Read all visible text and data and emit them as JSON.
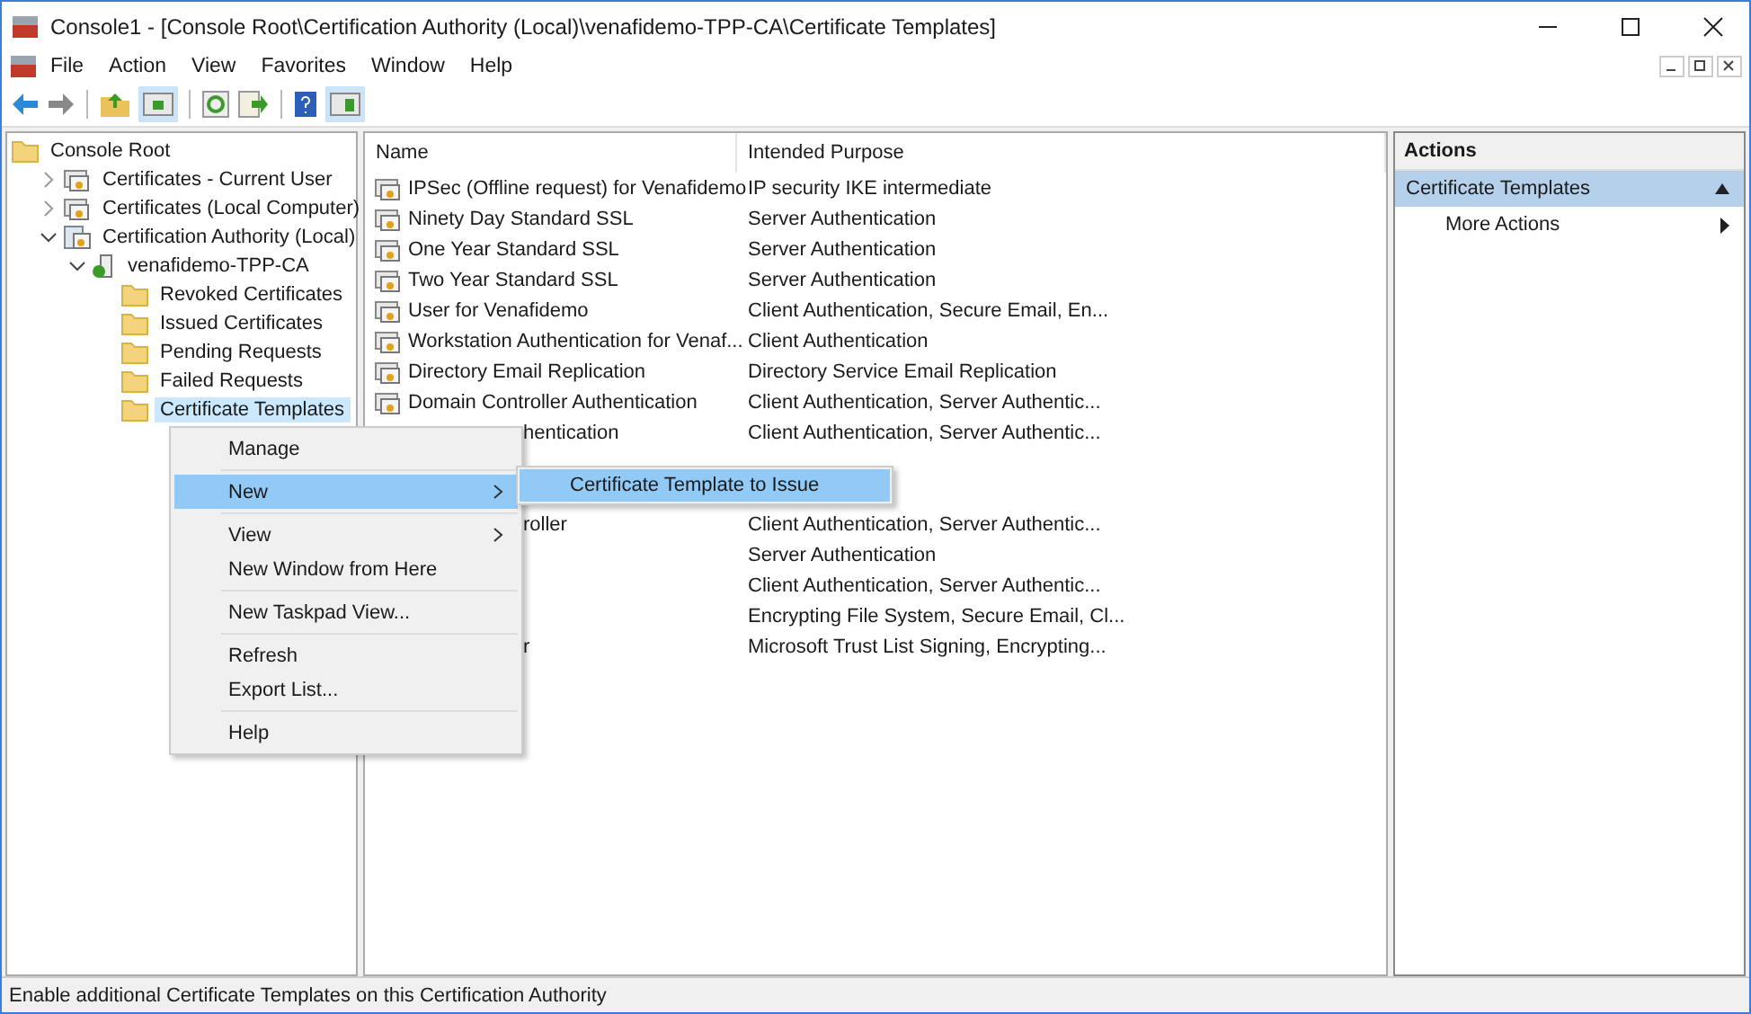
{
  "window": {
    "title": "Console1 - [Console Root\\Certification Authority (Local)\\venafidemo-TPP-CA\\Certificate Templates]"
  },
  "menu_bar": [
    "File",
    "Action",
    "View",
    "Favorites",
    "Window",
    "Help"
  ],
  "tree": [
    {
      "label": "Console Root",
      "children": [
        {
          "label": "Certificates - Current User",
          "expanded": false
        },
        {
          "label": "Certificates (Local Computer)",
          "expanded": false
        },
        {
          "label": "Certification Authority (Local)",
          "expanded": true,
          "children": [
            {
              "label": "venafidemo-TPP-CA",
              "expanded": true,
              "children": [
                {
                  "label": "Revoked Certificates",
                  "selected": false
                },
                {
                  "label": "Issued Certificates",
                  "selected": false
                },
                {
                  "label": "Pending Requests",
                  "selected": false
                },
                {
                  "label": "Failed Requests",
                  "selected": false
                },
                {
                  "label": "Certificate Templates",
                  "selected": true
                }
              ]
            }
          ]
        }
      ]
    }
  ],
  "list": {
    "columns": [
      "Name",
      "Intended Purpose"
    ],
    "rows": [
      {
        "kind": "full",
        "name": "IPSec (Offline request) for Venafidemo",
        "purpose": "IP security IKE intermediate"
      },
      {
        "kind": "full",
        "name": "Ninety Day Standard SSL",
        "purpose": "Server Authentication"
      },
      {
        "kind": "full",
        "name": "One Year Standard SSL",
        "purpose": "Server Authentication"
      },
      {
        "kind": "full",
        "name": "Two Year Standard SSL",
        "purpose": "Server Authentication"
      },
      {
        "kind": "full",
        "name": "User for Venafidemo",
        "purpose": "Client Authentication, Secure Email, En..."
      },
      {
        "kind": "full",
        "name": "Workstation Authentication for Venaf...",
        "purpose": "Client Authentication"
      },
      {
        "kind": "full",
        "name": "Directory Email Replication",
        "purpose": "Directory Service Email Replication"
      },
      {
        "kind": "full",
        "name": "Domain Controller Authentication",
        "purpose": "Client Authentication, Server Authentic..."
      },
      {
        "kind": "partial",
        "name": "hentication",
        "purpose": "Client Authentication, Server Authentic..."
      },
      {
        "kind": "hidden"
      },
      {
        "kind": "hidden"
      },
      {
        "kind": "partial",
        "name": "roller",
        "purpose": "Client Authentication, Server Authentic..."
      },
      {
        "kind": "partial",
        "purpose": "Server Authentication"
      },
      {
        "kind": "partial",
        "purpose": "Client Authentication, Server Authentic..."
      },
      {
        "kind": "partial",
        "purpose": "Encrypting File System, Secure Email, Cl..."
      },
      {
        "kind": "partial",
        "name": "r",
        "purpose": "Microsoft Trust List Signing, Encrypting..."
      }
    ]
  },
  "actions": {
    "title": "Actions",
    "section": "Certificate Templates",
    "items": [
      "More Actions"
    ]
  },
  "context_menu": {
    "groups": [
      [
        {
          "label": "Manage",
          "submenu": false,
          "selected": false
        }
      ],
      [
        {
          "label": "New",
          "submenu": true,
          "selected": true
        }
      ],
      [
        {
          "label": "View",
          "submenu": true,
          "selected": false
        },
        {
          "label": "New Window from Here",
          "submenu": false,
          "selected": false
        }
      ],
      [
        {
          "label": "New Taskpad View...",
          "submenu": false,
          "selected": false
        }
      ],
      [
        {
          "label": "Refresh",
          "submenu": false,
          "selected": false
        },
        {
          "label": "Export List...",
          "submenu": false,
          "selected": false
        }
      ],
      [
        {
          "label": "Help",
          "submenu": false,
          "selected": false
        }
      ]
    ],
    "submenu": [
      {
        "label": "Certificate Template to Issue",
        "selected": true
      }
    ]
  },
  "status_bar": "Enable additional Certificate Templates on this Certification Authority"
}
